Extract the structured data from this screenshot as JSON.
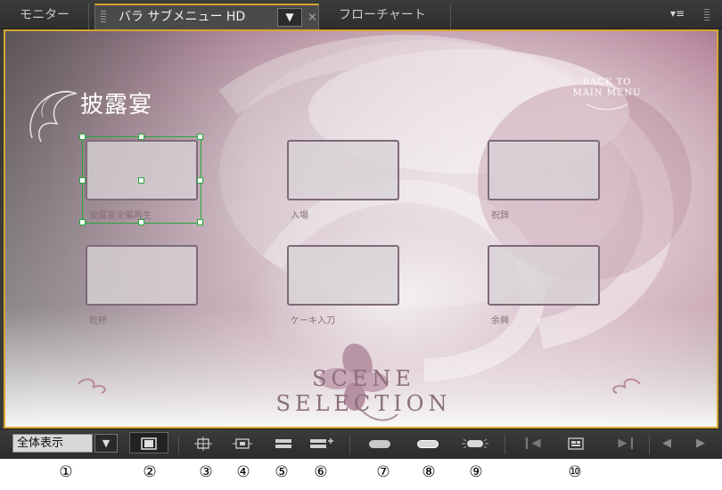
{
  "tabs": [
    {
      "label": "モニター"
    },
    {
      "label": "バラ サブメニュー HD",
      "dropdown": "▼",
      "close": "×"
    },
    {
      "label": "フローチャート"
    }
  ],
  "panel_menu_icon": "▾≡",
  "menu": {
    "title": "披露宴",
    "back_line1": "BACK TO",
    "back_line2": "MAIN MENU",
    "scene_selection": "SCENE SELECTION",
    "buttons": [
      {
        "label": "披露宴全編再生"
      },
      {
        "label": "入場"
      },
      {
        "label": "祝辞"
      },
      {
        "label": "乾杯"
      },
      {
        "label": "ケーキ入刀"
      },
      {
        "label": "余興"
      }
    ]
  },
  "toolbar": {
    "zoom_value": "全体表示",
    "zoom_arrow": "▼",
    "icons": [
      "safe-area-icon",
      "fit-icon",
      "center-icon",
      "grid-icon",
      "add-row-icon",
      "button-style-1-icon",
      "button-style-2-icon",
      "button-style-3-icon",
      "prev-icon",
      "preview-icon",
      "next-icon",
      "back-icon",
      "forward-icon"
    ]
  },
  "annotations": [
    "①",
    "②",
    "③",
    "④",
    "⑤",
    "⑥",
    "⑦",
    "⑧",
    "⑨",
    "⑩"
  ],
  "colors": {
    "accent": "#d8a530",
    "selection": "#27a83a",
    "rose": "#9b5a74"
  }
}
